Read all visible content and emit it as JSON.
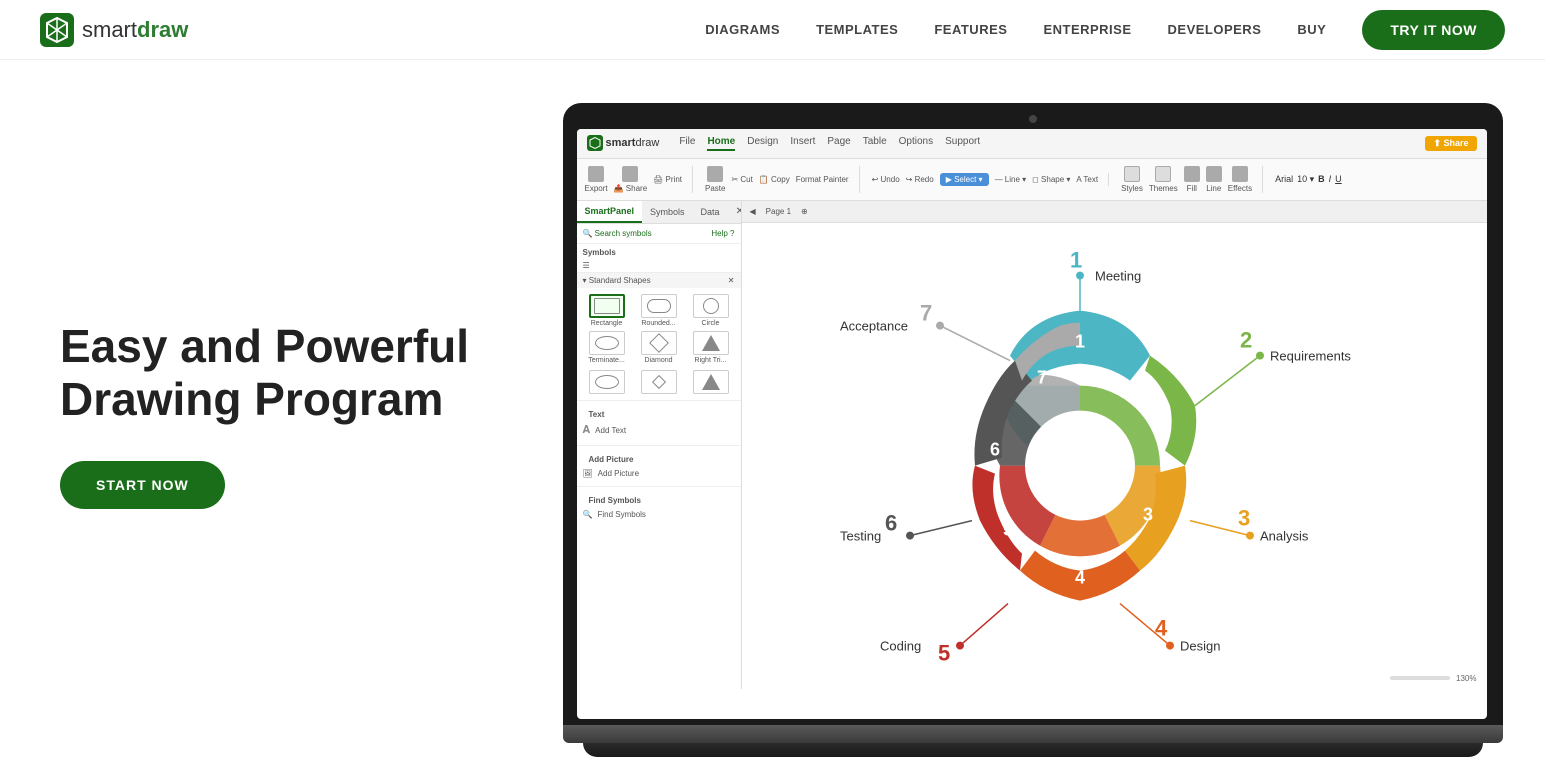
{
  "header": {
    "logo_smart": "smart",
    "logo_draw": "draw",
    "nav_items": [
      "DIAGRAMS",
      "TEMPLATES",
      "FEATURES",
      "ENTERPRISE",
      "DEVELOPERS",
      "BUY"
    ],
    "try_btn": "TRY IT NOW"
  },
  "hero": {
    "title_line1": "Easy and Powerful",
    "title_line2": "Drawing Program",
    "start_btn": "START NOW"
  },
  "app": {
    "menu_items": [
      "File",
      "Home",
      "Design",
      "Insert",
      "Page",
      "Table",
      "Options",
      "Support"
    ],
    "active_menu": "Home",
    "share_btn": "Share",
    "sidebar_tabs": [
      "SmartPanel",
      "Symbols",
      "Data"
    ],
    "search_label": "Search symbols 🔍",
    "help_label": "Help ?",
    "section_symbols": "Symbols",
    "standard_shapes": "Standard Shapes",
    "shapes": [
      {
        "label": "Rectangle"
      },
      {
        "label": "Rounded..."
      },
      {
        "label": "Circle"
      },
      {
        "label": "Terminate..."
      },
      {
        "label": "Diamond"
      },
      {
        "label": "Right Tri..."
      }
    ],
    "text_section": "Text",
    "add_text": "A  Add Text",
    "picture_section": "Add Picture",
    "add_picture": "Add Picture",
    "find_symbols": "Find Symbols",
    "find_symbols_label": "Find Symbols",
    "page_label": "Page 1",
    "zoom_level": "130%",
    "diagram_labels": {
      "meeting": "Meeting",
      "requirements": "Requirements",
      "acceptance": "Acceptance",
      "testing": "Testing",
      "coding": "Coding",
      "design": "Design",
      "analysis": "Analysis"
    },
    "diagram_numbers": {
      "one": "1",
      "two": "2",
      "three_req": "2",
      "three_anal": "3",
      "four_design": "4",
      "four_inner": "4",
      "five": "5",
      "six": "6",
      "seven": "7"
    }
  }
}
